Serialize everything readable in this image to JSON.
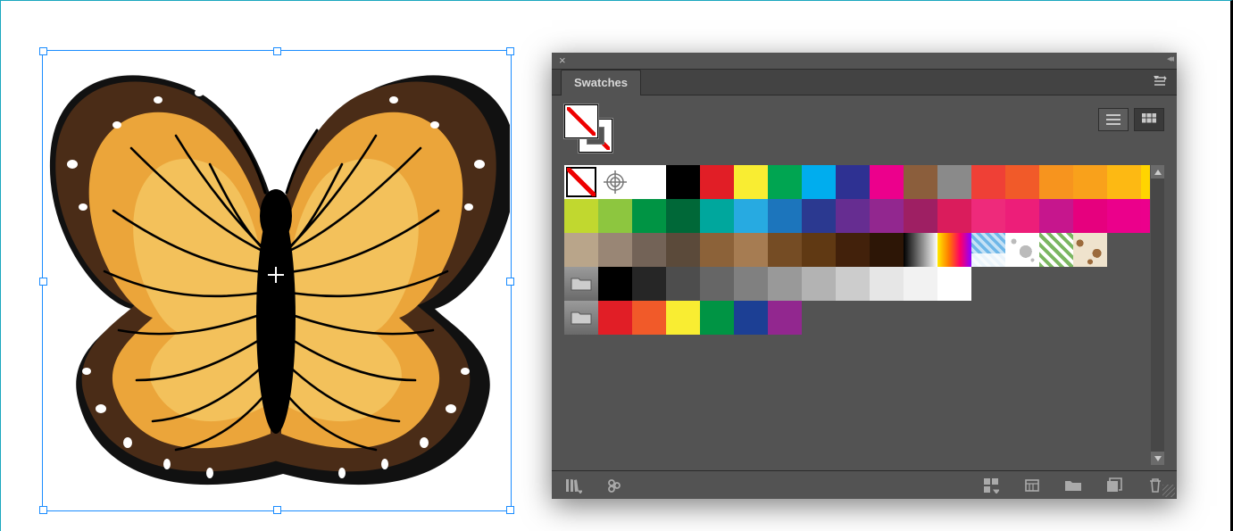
{
  "panel": {
    "title": "Swatches",
    "fill": "none",
    "stroke": "none",
    "view_mode": "grid"
  },
  "swatch_rows": [
    [
      {
        "t": "none"
      },
      {
        "t": "registration"
      },
      {
        "c": "#ffffff"
      },
      {
        "c": "#000000"
      },
      {
        "c": "#e11e26"
      },
      {
        "c": "#f9ed32"
      },
      {
        "c": "#00a551"
      },
      {
        "c": "#00adee"
      },
      {
        "c": "#2e3192"
      },
      {
        "c": "#ec008c"
      },
      {
        "c": "#8b5e3c"
      },
      {
        "c": "#8a8a8a"
      },
      {
        "c": "#ef4036"
      },
      {
        "c": "#f15a29"
      },
      {
        "c": "#f7941e"
      },
      {
        "c": "#f9a11b"
      },
      {
        "c": "#fdb913"
      },
      {
        "c": "#ffd400"
      }
    ],
    [
      {
        "c": "#c1d82f"
      },
      {
        "c": "#8dc63f"
      },
      {
        "c": "#009444"
      },
      {
        "c": "#006838"
      },
      {
        "c": "#00a79d"
      },
      {
        "c": "#27aae1"
      },
      {
        "c": "#1c75bc"
      },
      {
        "c": "#2b3990"
      },
      {
        "c": "#662d91"
      },
      {
        "c": "#92278f"
      },
      {
        "c": "#9e1f63"
      },
      {
        "c": "#da1c5c"
      },
      {
        "c": "#ee2a7b"
      },
      {
        "c": "#ed1e79"
      },
      {
        "c": "#c6168d"
      },
      {
        "c": "#e6007e"
      },
      {
        "c": "#eb008b"
      },
      {
        "c": "#ec008c"
      }
    ],
    [
      {
        "c": "#b9a58a"
      },
      {
        "c": "#998675"
      },
      {
        "c": "#736357"
      },
      {
        "c": "#5b4a3a"
      },
      {
        "c": "#8c6239"
      },
      {
        "c": "#a67c52"
      },
      {
        "c": "#754c24"
      },
      {
        "c": "#603913"
      },
      {
        "c": "#42210b"
      },
      {
        "c": "#2d1606"
      },
      {
        "t": "fade"
      },
      {
        "t": "spectrum"
      },
      {
        "t": "sky"
      },
      {
        "t": "dots"
      },
      {
        "t": "pat1"
      },
      {
        "t": "pat2"
      }
    ],
    [
      {
        "t": "folder"
      },
      {
        "c": "#000000"
      },
      {
        "c": "#262626"
      },
      {
        "c": "#4d4d4d"
      },
      {
        "c": "#666666"
      },
      {
        "c": "#808080"
      },
      {
        "c": "#999999"
      },
      {
        "c": "#b3b3b3"
      },
      {
        "c": "#cccccc"
      },
      {
        "c": "#e6e6e6"
      },
      {
        "c": "#f2f2f2"
      },
      {
        "c": "#ffffff"
      }
    ],
    [
      {
        "t": "folder"
      },
      {
        "c": "#e11e26"
      },
      {
        "c": "#f15a29"
      },
      {
        "c": "#f9ed32"
      },
      {
        "c": "#009444"
      },
      {
        "c": "#1c3f94"
      },
      {
        "c": "#92278f"
      }
    ]
  ],
  "footer_icons": [
    "library-menu",
    "show-kinds",
    "swatch-options",
    "new-group",
    "new-folder",
    "new-swatch",
    "delete-swatch"
  ]
}
